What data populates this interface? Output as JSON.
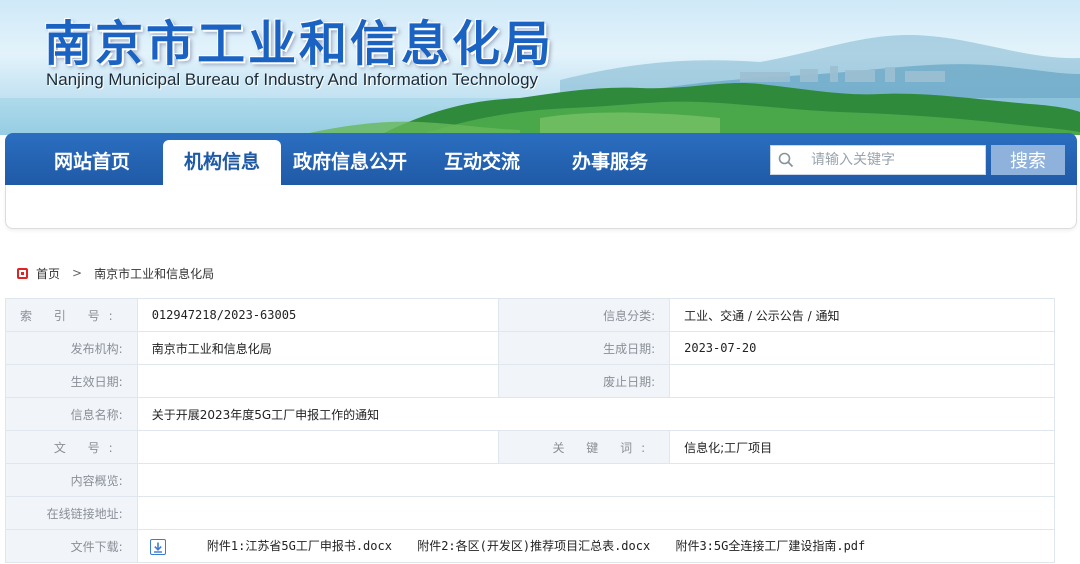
{
  "header": {
    "title": "南京市工业和信息化局",
    "subtitle": "Nanjing Municipal Bureau of Industry And Information Technology"
  },
  "nav": {
    "items": [
      {
        "label": "网站首页"
      },
      {
        "label": "机构信息"
      },
      {
        "label": "政府信息公开"
      },
      {
        "label": "互动交流"
      },
      {
        "label": "办事服务"
      }
    ],
    "active_index": 1,
    "search_placeholder": "请输入关键字",
    "search_button": "搜索"
  },
  "breadcrumb": {
    "home": "首页",
    "separator": ">",
    "current": "南京市工业和信息化局"
  },
  "info": {
    "index_no_label": "索 引 号:",
    "index_no": "012947218/2023-63005",
    "category_label": "信息分类:",
    "category": "工业、交通 / 公示公告 / 通知",
    "publisher_label": "发布机构:",
    "publisher": "南京市工业和信息化局",
    "created_label": "生成日期:",
    "created": "2023-07-20",
    "effective_label": "生效日期:",
    "effective": "",
    "abolished_label": "废止日期:",
    "abolished": "",
    "name_label": "信息名称:",
    "name": "关于开展2023年度5G工厂申报工作的通知",
    "doc_no_label": "文 号:",
    "doc_no": "",
    "keywords_label": "关 键 词:",
    "keywords": "信息化;工厂项目",
    "summary_label": "内容概览:",
    "summary": "",
    "link_label": "在线链接地址:",
    "link": "",
    "download_label": "文件下载:",
    "attachments": [
      "附件1:江苏省5G工厂申报书.docx",
      "附件2:各区(开发区)推荐项目汇总表.docx",
      "附件3:5G全连接工厂建设指南.pdf"
    ]
  },
  "colors": {
    "nav_blue": "#1f5aa6",
    "title_blue": "#1a63c3",
    "search_button": "#8fb2dc",
    "crumb_red": "#e02424"
  }
}
